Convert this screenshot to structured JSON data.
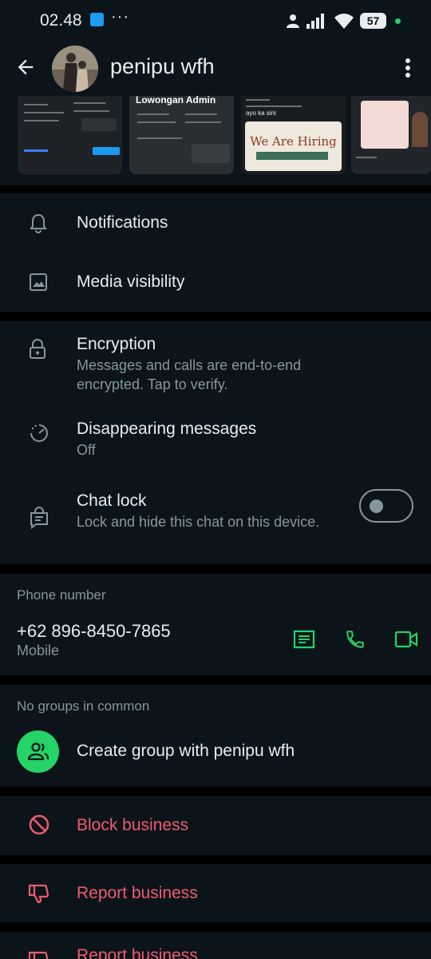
{
  "status_bar": {
    "time": "02.48",
    "more": "···",
    "battery": "57"
  },
  "header": {
    "contact_name": "penipu wfh"
  },
  "media": {
    "thumb2_heading": "Lowongan Admin",
    "thumb3_reply": "ayo ka sini",
    "thumb3_banner": "We Are Hiring"
  },
  "settings": {
    "notifications": "Notifications",
    "media_visibility": "Media visibility"
  },
  "privacy": {
    "encryption_title": "Encryption",
    "encryption_sub": "Messages and calls are end-to-end encrypted. Tap to verify.",
    "disappearing_title": "Disappearing messages",
    "disappearing_sub": "Off",
    "chat_lock_title": "Chat lock",
    "chat_lock_sub": "Lock and hide this chat on this device.",
    "chat_lock_enabled": false
  },
  "phone": {
    "label": "Phone number",
    "number": "+62 896-8450-7865",
    "type": "Mobile"
  },
  "groups": {
    "label": "No groups in common",
    "create": "Create group with penipu wfh"
  },
  "actions": {
    "block": "Block business",
    "report": "Report business",
    "report_cut": "Report business"
  },
  "colors": {
    "background": "#0b141a",
    "accent_green": "#25d366",
    "danger_red": "#f15c6d",
    "secondary_text": "#8696a0"
  },
  "icons": {
    "notifications": "bell-icon",
    "media": "image-icon",
    "encryption": "lock-icon",
    "disappearing": "timer-icon",
    "chat_lock": "chat-lock-icon",
    "message": "message-icon",
    "voice_call": "phone-icon",
    "video_call": "video-icon",
    "group": "group-icon",
    "block": "block-icon",
    "report": "thumbs-down-icon"
  }
}
